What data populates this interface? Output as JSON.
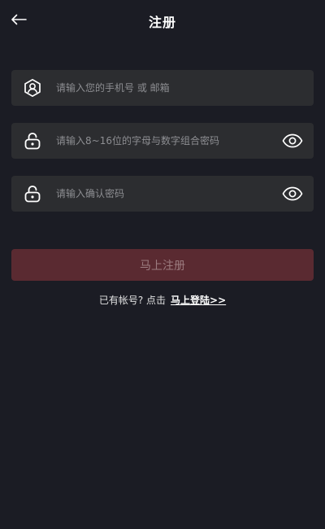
{
  "header": {
    "title": "注册",
    "back_icon": "arrow-left-icon"
  },
  "form": {
    "account": {
      "placeholder": "请输入您的手机号 或 邮箱",
      "value": "",
      "icon": "user-shield-icon"
    },
    "password": {
      "placeholder": "请输入8~16位的字母与数字组合密码",
      "value": "",
      "icon": "lock-icon",
      "toggle_icon": "eye-icon"
    },
    "confirm": {
      "placeholder": "请输入确认密码",
      "value": "",
      "icon": "lock-icon",
      "toggle_icon": "eye-icon"
    },
    "submit_label": "马上注册"
  },
  "footer": {
    "prompt": "已有帐号? 点击",
    "login_link": "马上登陆>>"
  },
  "colors": {
    "background": "#1b1c24",
    "field": "#2c2d30",
    "button": "#5a2a31",
    "button_text": "#9c7c80"
  }
}
